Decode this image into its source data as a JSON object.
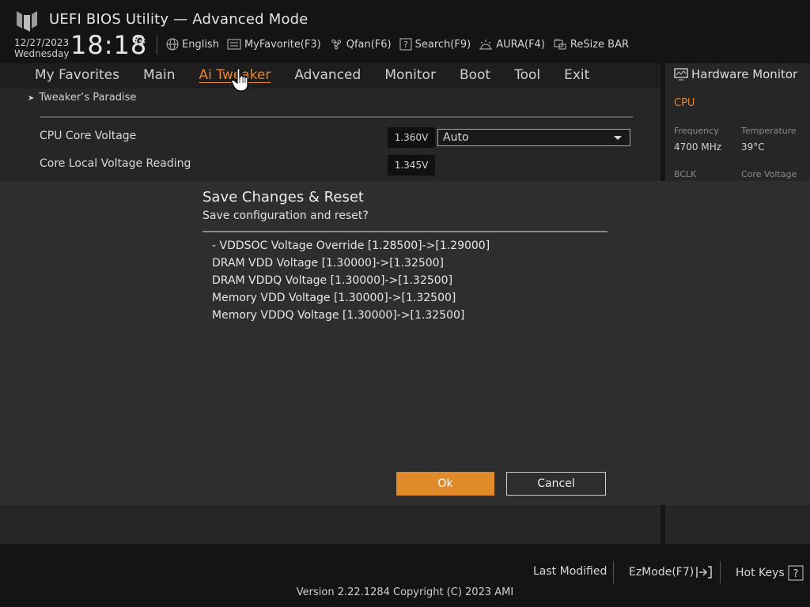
{
  "header": {
    "title": "UEFI BIOS Utility — Advanced Mode",
    "date": "12/27/2023",
    "weekday": "Wednesday",
    "time": "18:18"
  },
  "toolbar": {
    "language": "English",
    "myfavorite": "MyFavorite(F3)",
    "qfan": "Qfan(F6)",
    "search": "Search(F9)",
    "aura": "AURA(F4)",
    "resize_bar": "ReSize BAR"
  },
  "nav": {
    "tabs": [
      "My Favorites",
      "Main",
      "Ai Tweaker",
      "Advanced",
      "Monitor",
      "Boot",
      "Tool",
      "Exit"
    ],
    "active": "Ai Tweaker"
  },
  "main": {
    "breadcrumb": "Tweaker’s Paradise",
    "rows": [
      {
        "label": "CPU Core Voltage",
        "value": "1.360V",
        "select": "Auto"
      },
      {
        "label": "Core Local Voltage Reading",
        "value": "1.345V"
      }
    ]
  },
  "hardware_monitor": {
    "title": "Hardware Monitor",
    "section": "CPU",
    "frequency_label": "Frequency",
    "frequency_value": "4700 MHz",
    "temperature_label": "Temperature",
    "temperature_value": "39°C",
    "bclk_label": "BCLK",
    "core_voltage_label": "Core Voltage"
  },
  "dialog": {
    "title": "Save Changes & Reset",
    "subtitle": "Save configuration and reset?",
    "changes": [
      "- VDDSOC Voltage Override [1.28500]->[1.29000]",
      "DRAM VDD Voltage [1.30000]->[1.32500]",
      "DRAM VDDQ Voltage [1.30000]->[1.32500]",
      "Memory VDD Voltage [1.30000]->[1.32500]",
      "Memory VDDQ Voltage [1.30000]->[1.32500]"
    ],
    "ok_label": "Ok",
    "cancel_label": "Cancel"
  },
  "footer": {
    "last_modified": "Last Modified",
    "ezmode": "EzMode(F7)",
    "hot_keys": "Hot Keys",
    "version": "Version 2.22.1284 Copyright (C) 2023 AMI"
  },
  "colors": {
    "accent": "#e08a2a",
    "background": "#141414",
    "panel": "#262626",
    "dialog": "#2e2e2e"
  }
}
